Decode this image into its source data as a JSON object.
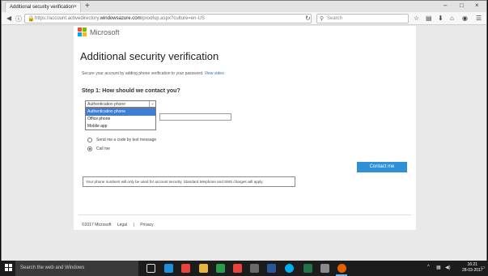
{
  "browser": {
    "tab_title": "Additional security verification",
    "tab_close": "×",
    "new_tab": "+",
    "url_prefix": "https://account.activedirectory.",
    "url_domain": "windowsazure.com",
    "url_suffix": "/proofup.aspx?culture=en-US",
    "search_placeholder": "Search",
    "window_controls": [
      "–",
      "□",
      "×"
    ]
  },
  "page": {
    "brand": "Microsoft",
    "title": "Additional security verification",
    "subtitle": "Secure your account by adding phone verification to your password.",
    "view_video": "View video",
    "step_heading": "Step 1: How should we contact you?",
    "contact_method": {
      "selected": "Authentication phone",
      "options": [
        "Authentication phone",
        "Office phone",
        "Mobile app"
      ]
    },
    "phone_number": "",
    "method_options": [
      {
        "label": "Send me a code by text message",
        "checked": false
      },
      {
        "label": "Call me",
        "checked": true
      }
    ],
    "contact_button": "Contact me",
    "notice": "Your phone numbers will only be used for account security. Standard telephone and SMS charges will apply.",
    "footer": {
      "copyright": "©2017 Microsoft",
      "legal": "Legal",
      "sep": "|",
      "privacy": "Privacy"
    }
  },
  "taskbar": {
    "search_placeholder": "Search the web and Windows",
    "time": "16:21",
    "date": "28-03-2017"
  },
  "colors": {
    "accent": "#2e90d8",
    "ms_red": "#f25022",
    "ms_green": "#7fba00",
    "ms_blue": "#00a4ef",
    "ms_yellow": "#ffb900"
  }
}
